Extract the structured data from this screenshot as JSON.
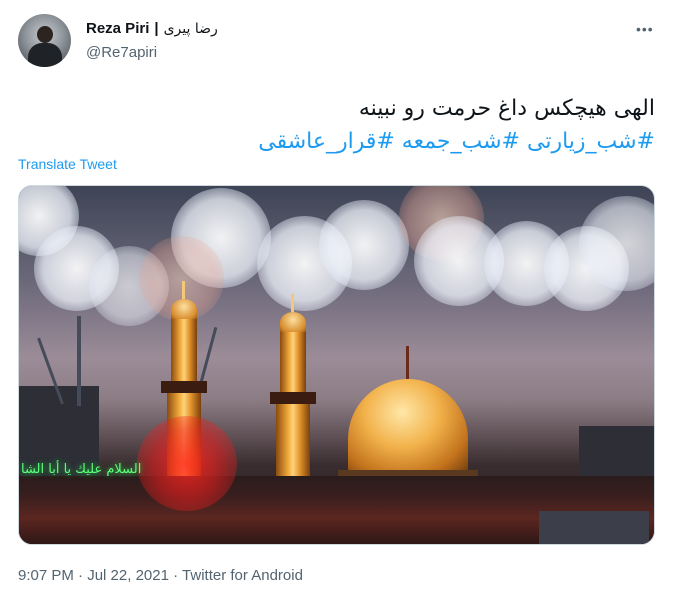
{
  "author": {
    "display_name": "Reza Piri",
    "separator": "|",
    "display_name_fa": "رضا پیری",
    "handle": "@Re7apiri"
  },
  "tweet": {
    "text": "الهی هیچکس داغ حرمت رو نبینه",
    "hashtags": "#شب_زیارتی #شب_جمعه #قرار_عاشقی",
    "translate_label": "Translate Tweet"
  },
  "media": {
    "sign_text": "السلام عليك يا أبا الشا"
  },
  "meta": {
    "time": "9:07 PM",
    "dot1": "·",
    "date": "Jul 22, 2021",
    "dot2": "·",
    "client": "Twitter for Android"
  },
  "icons": {
    "more": "more-horizontal-icon"
  },
  "colors": {
    "link": "#1d9bf0",
    "secondary_text": "#536471",
    "primary_text": "#0f1419"
  }
}
